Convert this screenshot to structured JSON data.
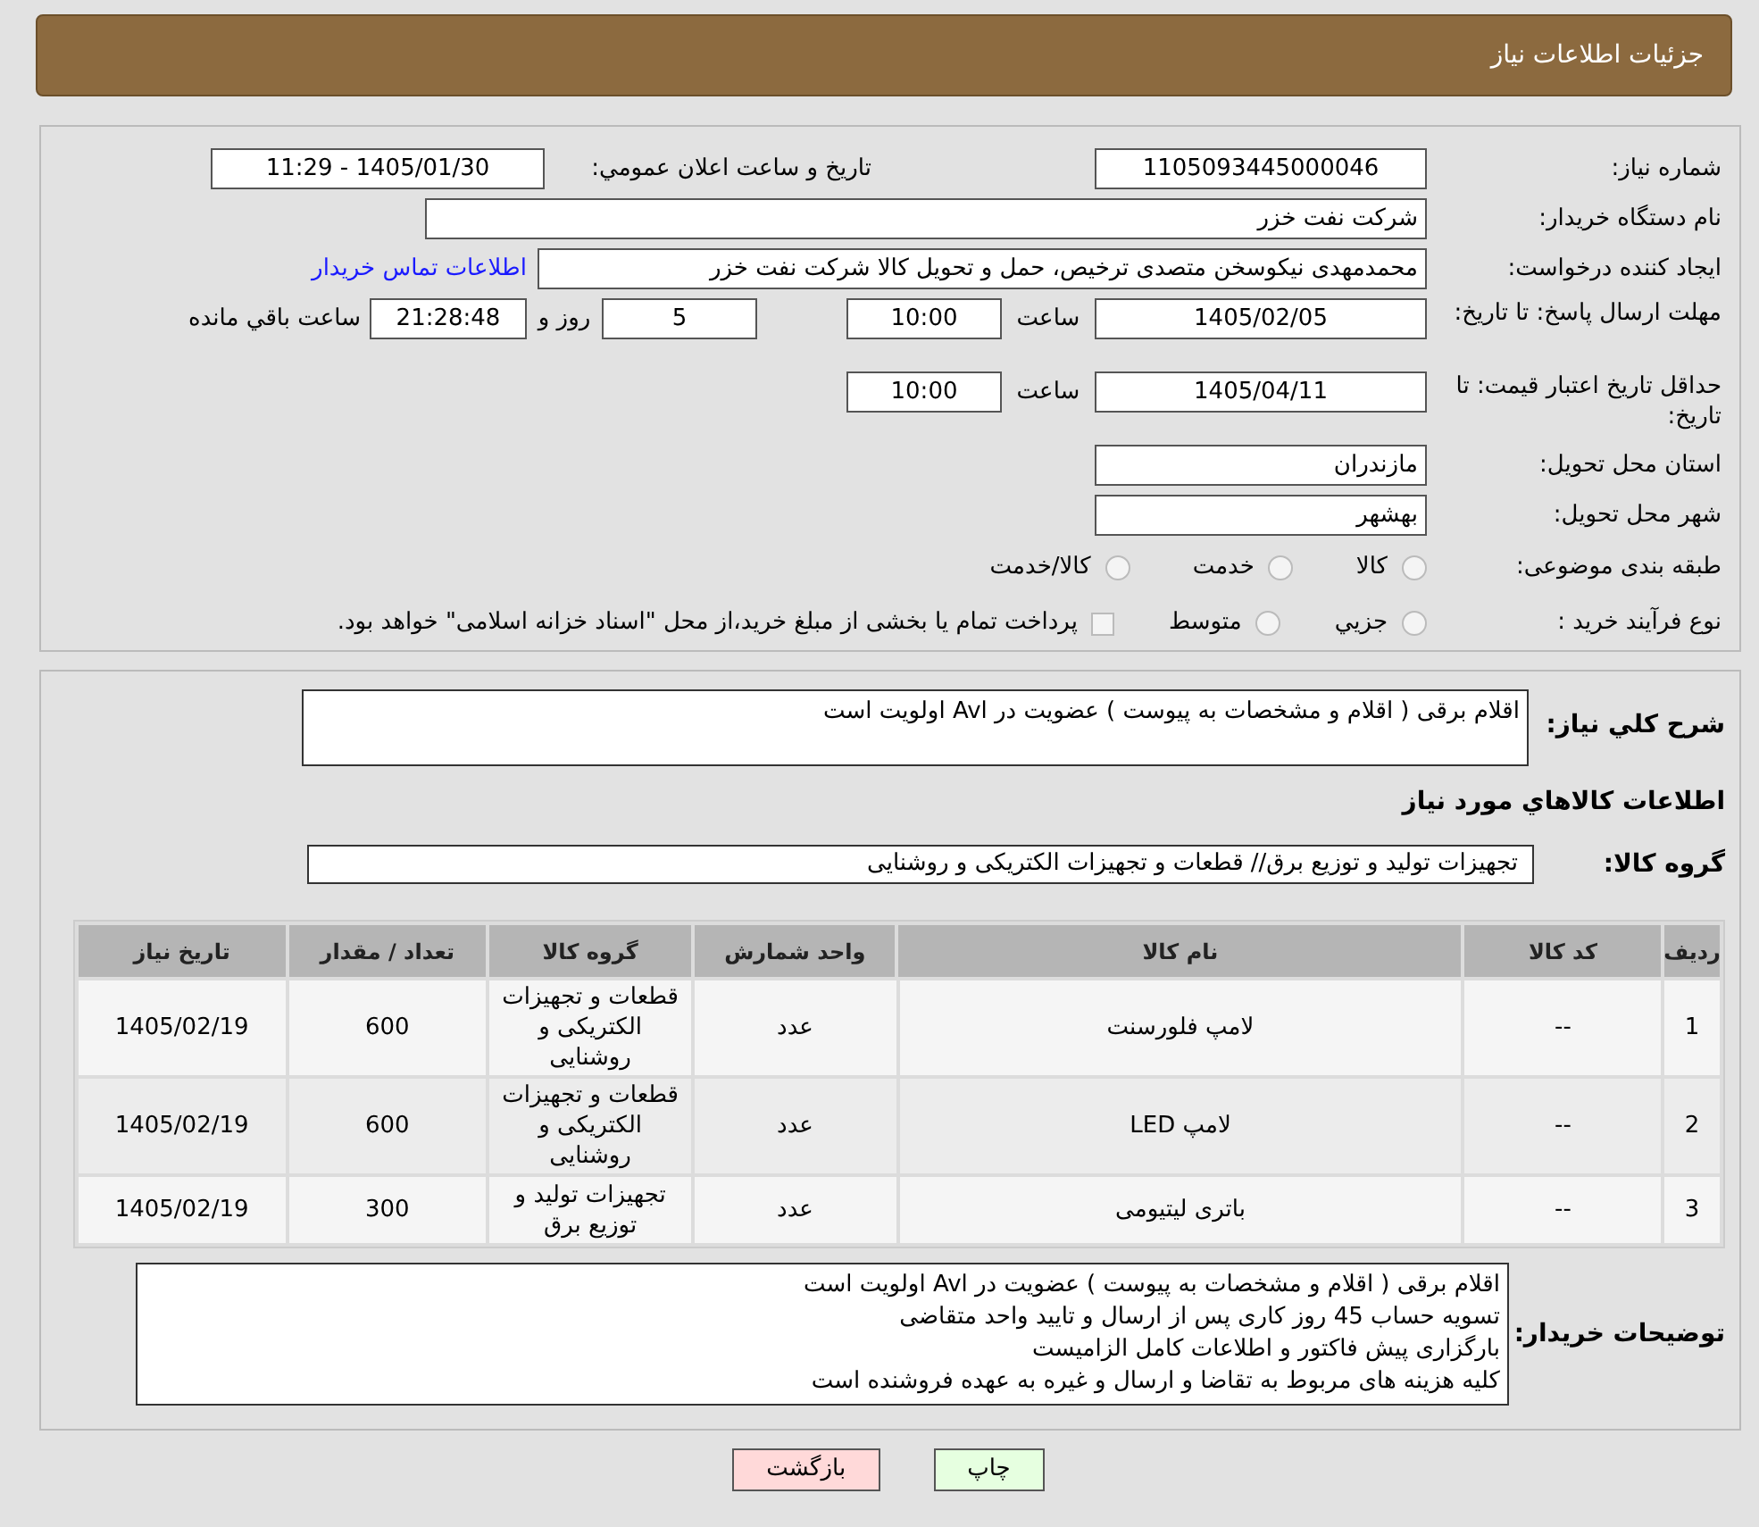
{
  "header": {
    "title": "جزئیات اطلاعات نیاز"
  },
  "form": {
    "need_number": {
      "label": "شماره نیاز:",
      "value": "1105093445000046"
    },
    "announce": {
      "label": "تاریخ و ساعت اعلان عمومي:",
      "value": "1405/01/30 - 11:29"
    },
    "buyer": {
      "label": "نام دستگاه خریدار:",
      "value": "شرکت نفت خزر"
    },
    "requester": {
      "label": "ایجاد کننده درخواست:",
      "value": "محمدمهدی نیکوسخن متصدی ترخیص، حمل و تحویل کالا شرکت نفت خزر",
      "link": "اطلاعات تماس خریدار"
    },
    "reply_deadline": {
      "label": "مهلت ارسال پاسخ: تا تاریخ:",
      "date": "1405/02/05",
      "time_label": "ساعت",
      "time": "10:00",
      "days": "5",
      "days_label": "روز و",
      "remaining": "21:28:48",
      "remaining_label": "ساعت باقي مانده"
    },
    "price_validity": {
      "label": "حداقل تاریخ اعتبار قیمت: تا تاریخ:",
      "date": "1405/04/11",
      "time_label": "ساعت",
      "time": "10:00"
    },
    "province": {
      "label": "استان محل تحویل:",
      "value": "مازندران"
    },
    "city": {
      "label": "شهر محل تحویل:",
      "value": "بهشهر"
    },
    "category": {
      "label": "طبقه بندی موضوعی:",
      "options": [
        {
          "label": "کالا",
          "selected": false
        },
        {
          "label": "خدمت",
          "selected": false
        },
        {
          "label": "کالا/خدمت",
          "selected": false
        }
      ]
    },
    "purchase_type": {
      "label": "نوع فرآیند خرید :",
      "options": [
        {
          "label": "جزيي",
          "selected": false
        },
        {
          "label": "متوسط",
          "selected": false
        }
      ],
      "treasury": {
        "checked": false,
        "text": "پرداخت تمام یا بخشی از مبلغ خرید،از محل \"اسناد خزانه اسلامی\" خواهد بود."
      }
    }
  },
  "details": {
    "description": {
      "label": "شرح کلي نياز:",
      "value": "اقلام برقی ( اقلام و مشخصات به پیوست ) عضویت در Avl اولویت است"
    },
    "items_title": "اطلاعات کالاهاي مورد نياز",
    "goods_group": {
      "label": "گروه کالا:",
      "value": "تجهیزات تولید و توزیع برق// قطعات و تجهیزات الکتریکی و روشنایی"
    },
    "table": {
      "columns": [
        "ردیف",
        "کد کالا",
        "نام کالا",
        "واحد شمارش",
        "گروه کالا",
        "تعداد / مقدار",
        "تاریخ نیاز"
      ],
      "rows": [
        [
          "1",
          "--",
          "لامپ فلورسنت",
          "عدد",
          "قطعات و تجهیزات الکتریکی و روشنایی",
          "600",
          "1405/02/19"
        ],
        [
          "2",
          "--",
          "لامپ LED",
          "عدد",
          "قطعات و تجهیزات الکتریکی و روشنایی",
          "600",
          "1405/02/19"
        ],
        [
          "3",
          "--",
          "باتری لیتیومی",
          "عدد",
          "تجهیزات تولید و توزیع برق",
          "300",
          "1405/02/19"
        ]
      ]
    },
    "buyer_notes": {
      "label": "توضیحات خریدار:",
      "lines": [
        "اقلام برقی ( اقلام و مشخصات به پیوست ) عضویت در Avl اولویت است",
        "تسویه حساب 45 روز کاری پس از ارسال و تایید واحد متقاضی",
        "بارگزاری پیش فاکتور و اطلاعات کامل الزامیست",
        "کلیه هزینه های مربوط به تقاضا و ارسال و غیره به عهده فروشنده است"
      ]
    }
  },
  "buttons": [
    {
      "kind": "print",
      "label": "چاپ"
    },
    {
      "kind": "back",
      "label": "بازگشت"
    }
  ]
}
